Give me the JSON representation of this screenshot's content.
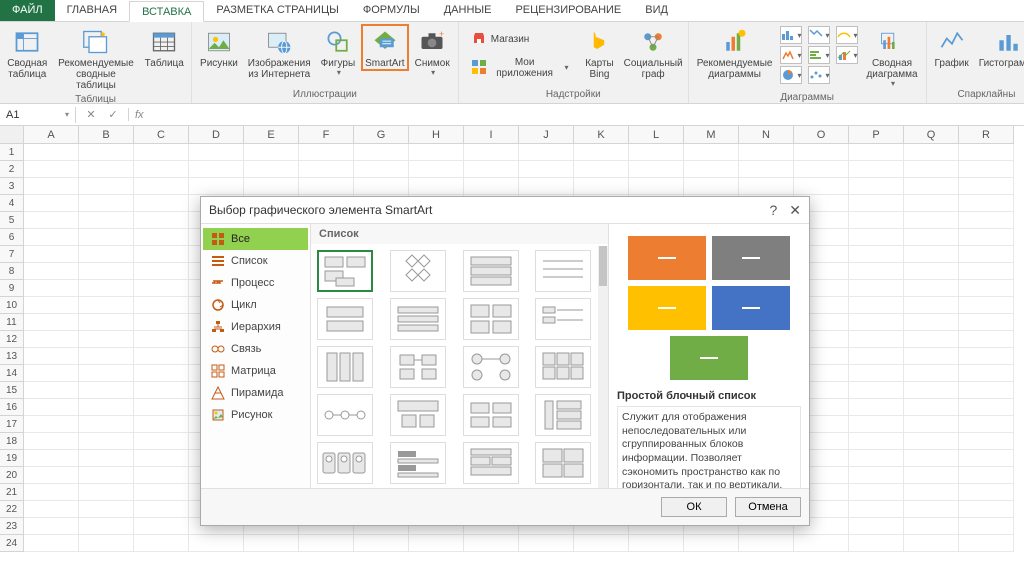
{
  "tabs": [
    "ФАЙЛ",
    "ГЛАВНАЯ",
    "ВСТАВКА",
    "РАЗМЕТКА СТРАНИЦЫ",
    "ФОРМУЛЫ",
    "ДАННЫЕ",
    "РЕЦЕНЗИРОВАНИЕ",
    "ВИД"
  ],
  "active_tab_index": 2,
  "ribbon": {
    "groups": {
      "tables": {
        "label": "Таблицы",
        "pivot": "Сводная\nтаблица",
        "rec_pivot": "Рекомендуемые\nсводные таблицы",
        "table": "Таблица"
      },
      "illustrations": {
        "label": "Иллюстрации",
        "pictures": "Рисунки",
        "online": "Изображения\nиз Интернета",
        "shapes": "Фигуры",
        "smartart": "SmartArt",
        "screenshot": "Снимок"
      },
      "addins": {
        "label": "Надстройки",
        "store": "Магазин",
        "myapps": "Мои приложения"
      },
      "apps": {
        "bing": "Карты\nBing",
        "social": "Социальный\nграф"
      },
      "charts": {
        "label": "Диаграммы",
        "recommended": "Рекомендуемые\nдиаграммы",
        "pivot_chart": "Сводная\nдиаграмма"
      },
      "sparklines": {
        "label": "Спарклайны",
        "line": "График",
        "column": "Гистограмма"
      }
    }
  },
  "name_box": "A1",
  "columns": [
    "A",
    "B",
    "C",
    "D",
    "E",
    "F",
    "G",
    "H",
    "I",
    "J",
    "K",
    "L",
    "M",
    "N",
    "O",
    "P",
    "Q",
    "R"
  ],
  "rows": 24,
  "dialog": {
    "title": "Выбор графического элемента SmartArt",
    "help": "?",
    "sidebar": [
      "Все",
      "Список",
      "Процесс",
      "Цикл",
      "Иерархия",
      "Связь",
      "Матрица",
      "Пирамида",
      "Рисунок"
    ],
    "active_sidebar": 0,
    "gallery_header": "Список",
    "preview": {
      "title": "Простой блочный список",
      "desc": "Служит для отображения непоследовательных или сгруппированных блоков информации. Позволяет сэкономить пространство как по горизонтали, так и по вертикали.",
      "colors": [
        "#ed7d31",
        "#7f7f7f",
        "#ffc000",
        "#4472c4",
        "#70ad47"
      ]
    },
    "ok": "ОК",
    "cancel": "Отмена"
  }
}
